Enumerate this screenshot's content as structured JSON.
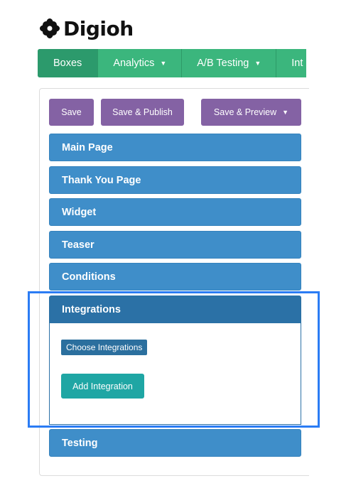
{
  "brand": {
    "name": "Digioh"
  },
  "nav": {
    "items": [
      {
        "label": "Boxes"
      },
      {
        "label": "Analytics",
        "caret": "▼"
      },
      {
        "label": "A/B Testing",
        "caret": "▼"
      },
      {
        "label": "Int"
      }
    ]
  },
  "toolbar": {
    "save_label": "Save",
    "save_publish_label": "Save & Publish",
    "save_preview_label": "Save & Preview",
    "preview_caret": "▼"
  },
  "sections": {
    "main_page": "Main Page",
    "thank_you_page": "Thank You Page",
    "widget": "Widget",
    "teaser": "Teaser",
    "conditions": "Conditions",
    "integrations": "Integrations",
    "testing": "Testing"
  },
  "integrations_panel": {
    "choose_label": "Choose Integrations",
    "add_label": "Add Integration"
  },
  "colors": {
    "nav_green": "#3bb67d",
    "purple": "#8462a4",
    "section_blue": "#3f8ec9",
    "teal": "#1fa6a4",
    "highlight": "#2b7cf4"
  }
}
